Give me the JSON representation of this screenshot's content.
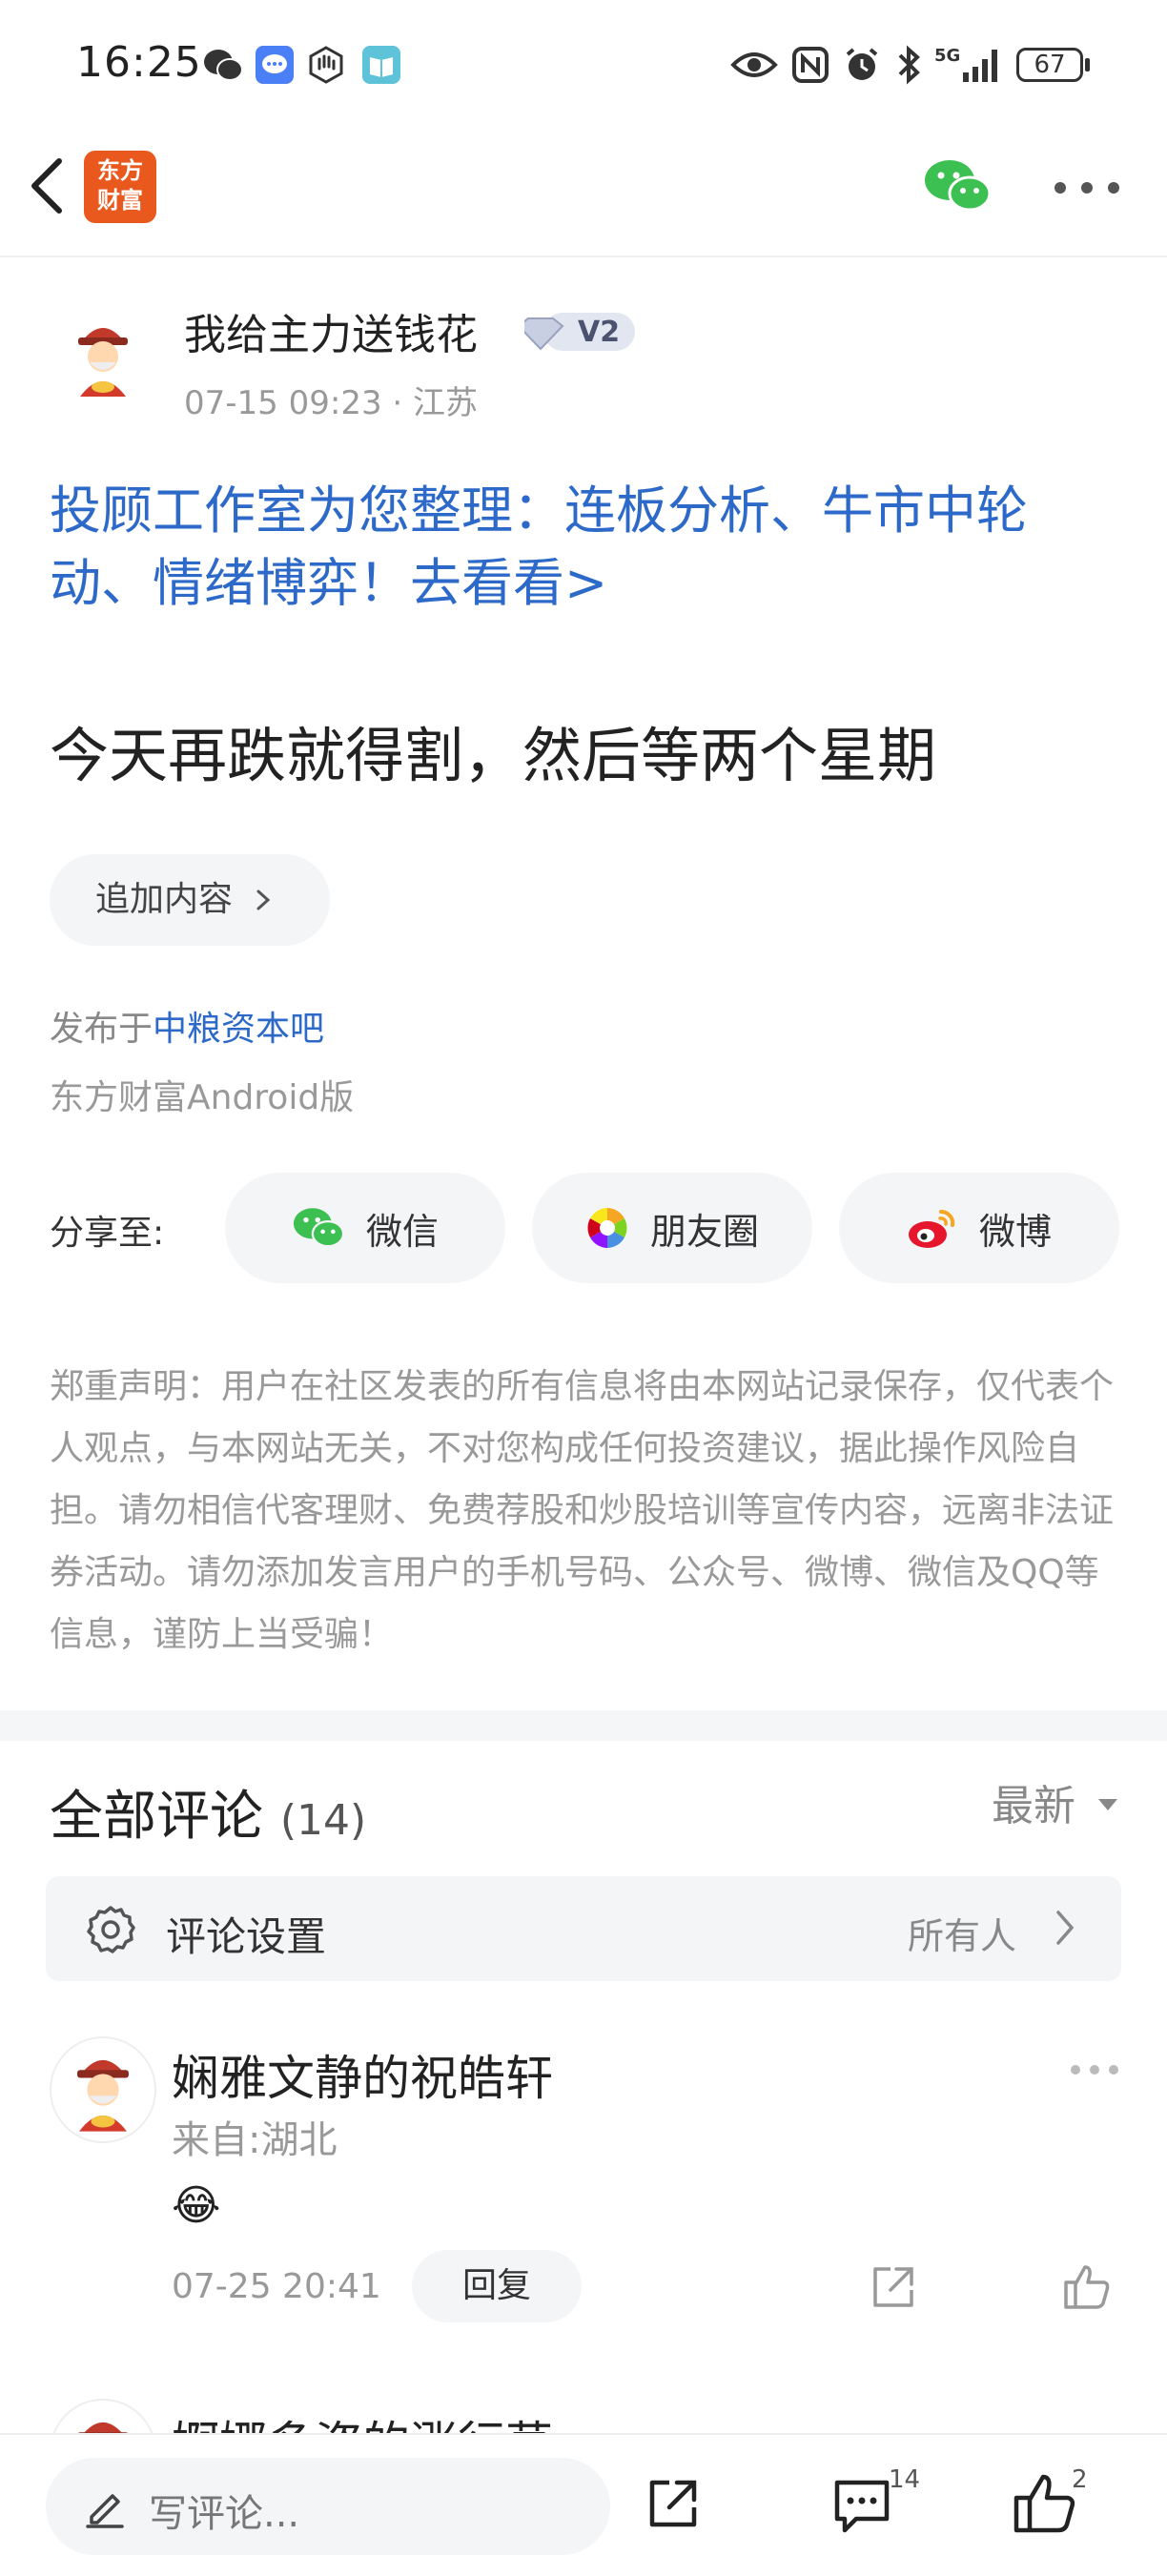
{
  "status_bar": {
    "time": "16:25",
    "battery": "67",
    "left_icons": [
      "wechat-icon",
      "chat-app-icon",
      "hand-icon",
      "reader-icon"
    ],
    "right_icons": [
      "eye-icon",
      "nfc-icon",
      "alarm-icon",
      "bluetooth-icon",
      "signal-5g-icon",
      "battery-icon"
    ]
  },
  "header": {
    "logo_text": [
      "东方",
      "财富"
    ]
  },
  "post": {
    "author": "我给主力送钱花",
    "level_badge": "V2",
    "meta": "07-15 09:23 · 江苏",
    "promo_link": "投顾工作室为您整理：连板分析、牛市中轮动、情绪博弈！去看看>",
    "content": "今天再跌就得割，然后等两个星期",
    "append_button": "追加内容",
    "published_prefix": "发布于",
    "forum_name": "中粮资本吧",
    "client": "东方财富Android版",
    "share_label": "分享至:",
    "share_targets": [
      "微信",
      "朋友圈",
      "微博"
    ],
    "disclaimer": "郑重声明：用户在社区发表的所有信息将由本网站记录保存，仅代表个人观点，与本网站无关，不对您构成任何投资建议，据此操作风险自担。请勿相信代客理财、免费荐股和炒股培训等宣传内容，远离非法证券活动。请勿添加发言用户的手机号码、公众号、微博、微信及QQ等信息，谨防上当受骗！"
  },
  "comments": {
    "title": "全部评论",
    "count": "(14)",
    "sort": "最新",
    "settings_label": "评论设置",
    "settings_value": "所有人",
    "items": [
      {
        "name": "娴雅文静的祝皓轩",
        "location": "来自:湖北",
        "emoji": "😂",
        "time": "07-25 20:41",
        "reply_label": "回复"
      },
      {
        "name": "婀娜多姿的涨行草"
      }
    ]
  },
  "bottom_bar": {
    "write_placeholder": "写评论...",
    "comment_count": "14",
    "like_count": "2"
  },
  "colors": {
    "accent_blue": "#2c69c8",
    "brand_orange": "#e9581c",
    "wechat_green": "#3cc051"
  }
}
